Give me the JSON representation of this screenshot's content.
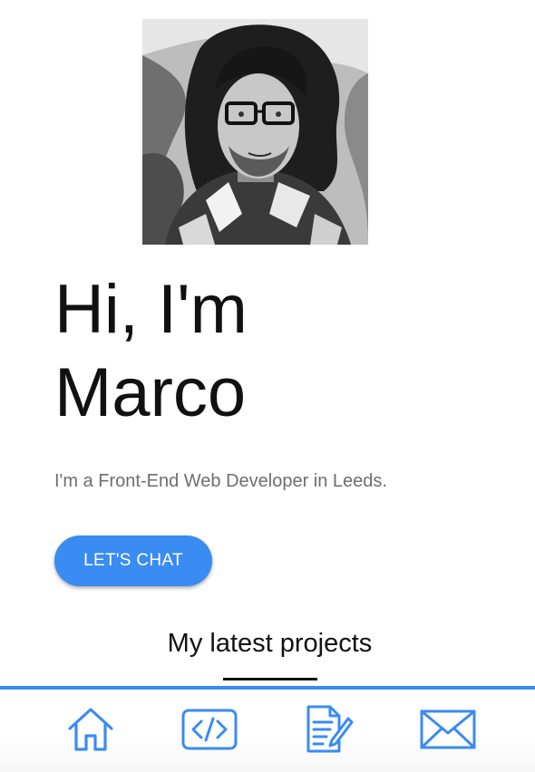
{
  "profile": {
    "photo_description_icon": "profile-photo",
    "headline_line1": "Hi, I'm",
    "headline_line2": "Marco",
    "tagline": "I'm a Front-End Web Developer in Leeds."
  },
  "cta": {
    "label": "LET'S CHAT"
  },
  "projects": {
    "title": "My latest projects"
  },
  "bottom_nav": {
    "items": [
      {
        "icon": "home-icon"
      },
      {
        "icon": "code-icon"
      },
      {
        "icon": "document-edit-icon"
      },
      {
        "icon": "mail-icon"
      }
    ]
  },
  "colors": {
    "accent": "#3a8bf2",
    "text": "#111111",
    "muted": "#6e6e6e"
  }
}
